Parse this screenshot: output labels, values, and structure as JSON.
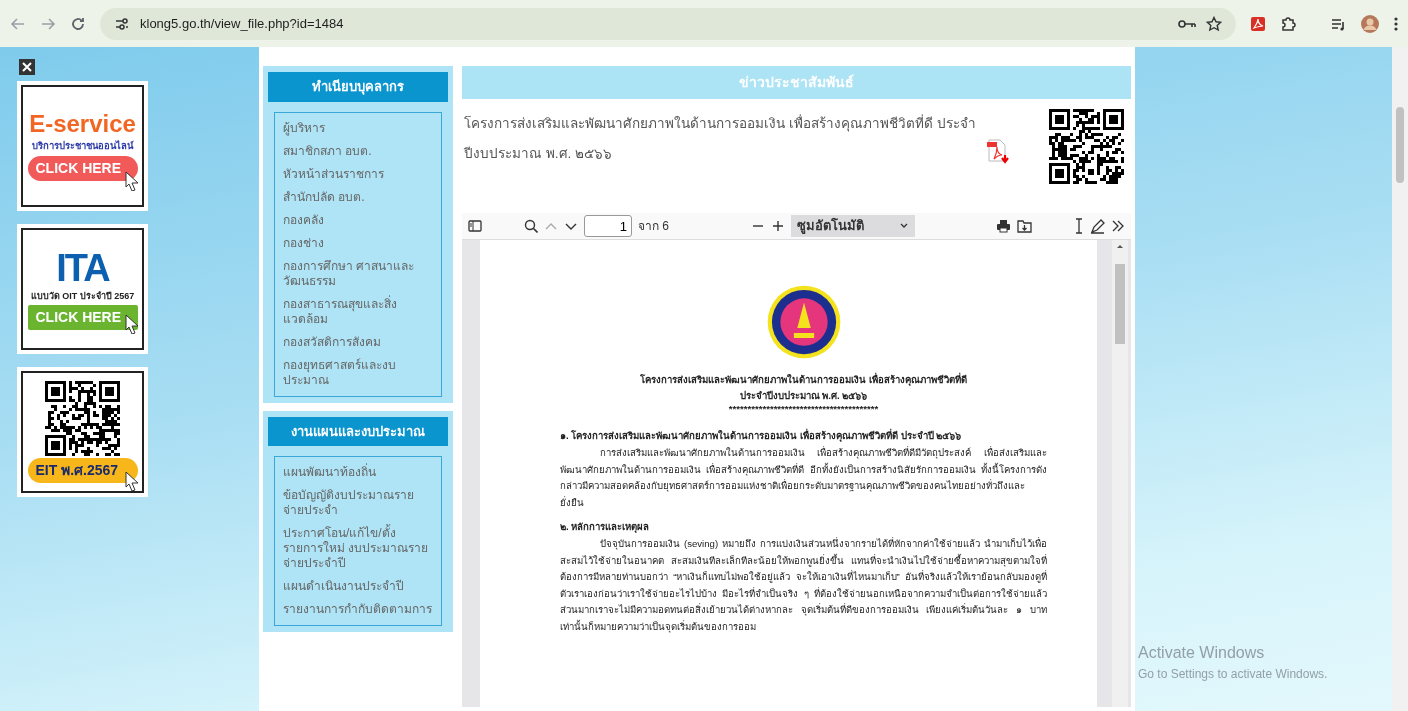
{
  "browser": {
    "url": "klong5.go.th/view_file.php?id=1484"
  },
  "banners": [
    {
      "kind": "eservice",
      "title": "E-service",
      "subtitle": "บริการประชาชนออนไลน์",
      "button": "CLICK HERE"
    },
    {
      "kind": "ita",
      "title": "ITA",
      "subtitle": "แบบวัด OIT ประจำปี 2567",
      "button": "CLICK HERE"
    },
    {
      "kind": "qr",
      "button": "EIT พ.ศ.2567"
    }
  ],
  "sidebar": [
    {
      "title": "ทำเนียบบุคลากร",
      "items": [
        "ผู้บริหาร",
        "สมาชิกสภา อบต.",
        "หัวหน้าส่วนราชการ",
        "สำนักปลัด อบต.",
        "กองคลัง",
        "กองช่าง",
        "กองการศึกษา ศาสนาและวัฒนธรรม",
        "กองสาธารณสุขและสิ่งแวดล้อม",
        "กองสวัสดิการสังคม",
        "กองยุทธศาสตร์และงบประมาณ"
      ]
    },
    {
      "title": "งานแผนและงบประมาณ",
      "items": [
        "แผนพัฒนาท้องถิ่น",
        "ข้อบัญญัติงบประมาณรายจ่ายประจำ",
        "ประกาศโอน/แก้ไข/ตั้งรายการใหม่ งบประมาณรายจ่ายประจำปี",
        "แผนดำเนินงานประจำปี",
        "รายงานการกำกับติดตามการ"
      ]
    }
  ],
  "content": {
    "heading": "ข่าวประชาสัมพันธ์",
    "news_title": "โครงการส่งเสริมและพัฒนาศักยภาพในด้านการออมเงิน เพื่อสร้างคุณภาพชีวิตที่ดี ประจำปีงบประมาณ พ.ศ. ๒๕๖๖",
    "pdf_viewer": {
      "page": "1",
      "page_total": "จาก 6",
      "zoom": "ซูมอัตโนมัติ",
      "document": {
        "title_lines": [
          "โครงการส่งเสริมและพัฒนาศักยภาพในด้านการออมเงิน เพื่อสร้างคุณภาพชีวิตที่ดี",
          "ประจำปีงบประมาณ พ.ศ. ๒๕๖๖"
        ],
        "rule": "****************************************",
        "sections": [
          {
            "heading": "๑. โครงการส่งเสริมและพัฒนาศักยภาพในด้านการออมเงิน เพื่อสร้างคุณภาพชีวิตที่ดี ประจำปี ๒๕๖๖",
            "paragraph": "การส่งเสริมและพัฒนาศักยภาพในด้านการออมเงิน เพื่อสร้างคุณภาพชีวิตที่ดีมีวัตถุประสงค์ เพื่อส่งเสริมและพัฒนาศักยภาพในด้านการออมเงิน เพื่อสร้างคุณภาพชีวิตที่ดี อีกทั้งยังเป็นการสร้างนิสัยรักการออมเงิน ทั้งนี้โครงการดังกล่าวมีความสอดคล้องกับยุทธศาสตร์การออมแห่งชาติเพื่อยกระดับมาตรฐานคุณภาพชีวิตของคนไทยอย่างทั่วถึงและยั่งยืน"
          },
          {
            "heading": "๒. หลักการและเหตุผล",
            "paragraph": "ปัจจุบันการออมเงิน (seving) หมายถึง การแบ่งเงินส่วนหนึ่งจากรายได้ที่หักจากค่าใช้จ่ายแล้ว นำมาเก็บไว้เพื่อสะสมไว้ใช้จ่ายในอนาคต สะสมเงินทีละเล็กทีละน้อยให้พอกพูนยิ่งขึ้น แทนที่จะนำเงินไปใช้จ่ายซื้อหาความสุขตามใจที่ต้องการมีหลายท่านบอกว่า “หาเงินก็แทบไม่พอใช้อยู่แล้ว จะให้เอาเงินที่ไหนมาเก็บ” อันที่จริงแล้วให้เราย้อนกลับมองดูที่ตัวเราเองก่อนว่าเราใช้จ่ายอะไรไปบ้าง มีอะไรที่จำเป็นจริง ๆ ที่ต้องใช้จ่ายนอกเหนือจากความจำเป็นต่อการใช้จ่ายแล้ว ส่วนมากเราจะไม่มีความอดทนต่อสิ่งเย้ายวนได้ต่างหากละ จุดเริ่มต้นที่ดีของการออมเงิน เพียงแค่เริ่มต้นวันละ ๑ บาท เท่านั้นก็หมายความว่าเป็นจุดเริ่มต้นของการออม"
          }
        ]
      }
    }
  },
  "os_notice": {
    "title": "Activate Windows",
    "subtitle": "Go to Settings to activate Windows."
  }
}
